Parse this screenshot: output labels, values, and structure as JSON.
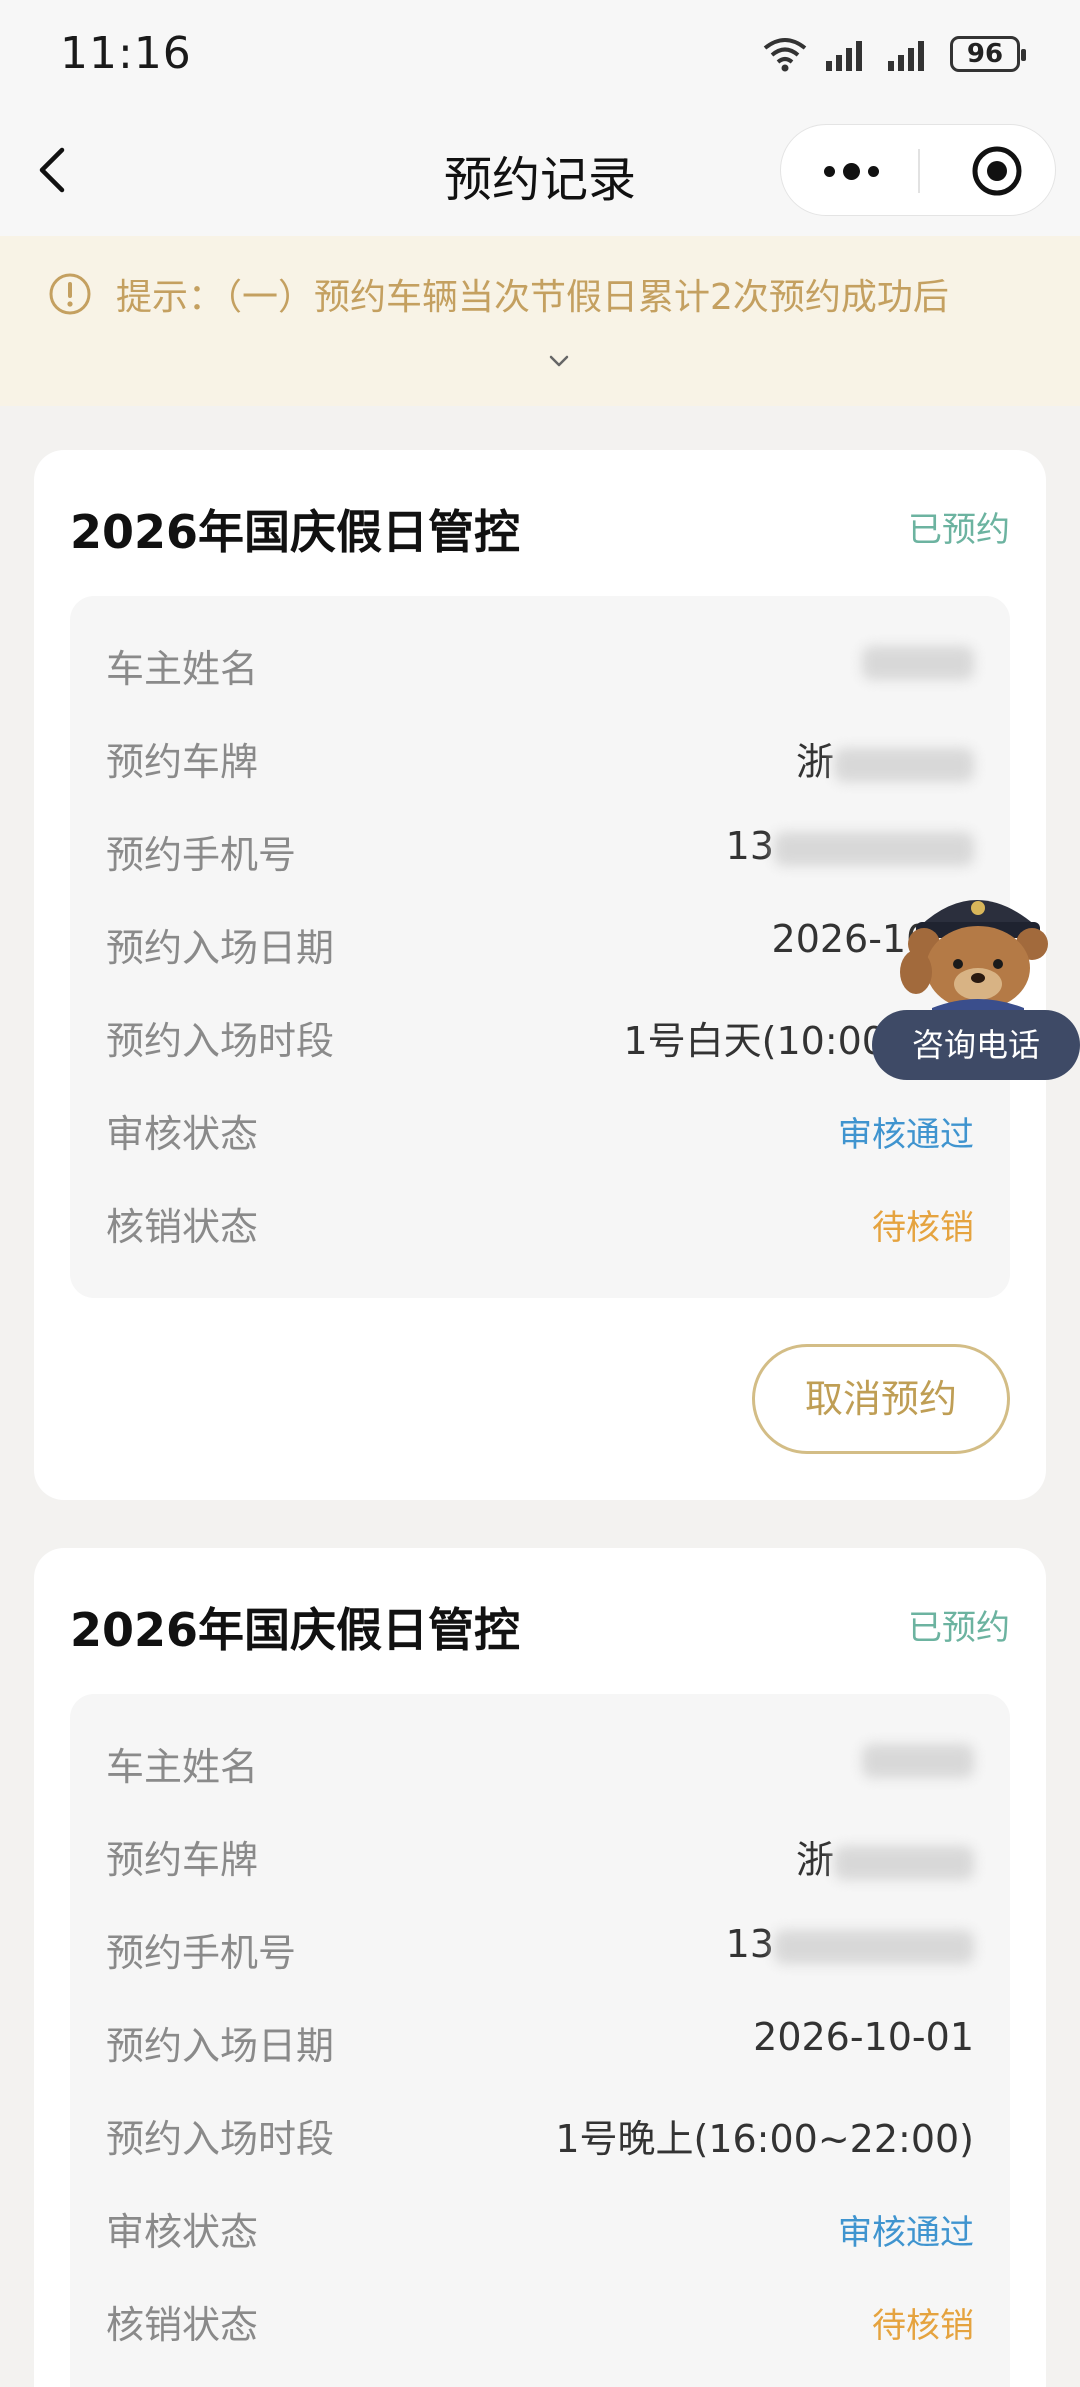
{
  "status_bar": {
    "time": "11:16",
    "battery": "96"
  },
  "nav": {
    "title": "预约记录"
  },
  "notice": {
    "text": "提示：（一）预约车辆当次节假日累计2次预约成功后"
  },
  "consult": {
    "label": "咨询电话"
  },
  "records": [
    {
      "title": "2026年国庆假日管控",
      "status": "已预约",
      "rows": [
        {
          "label": "车主姓名",
          "value": ""
        },
        {
          "label": "预约车牌",
          "value": "浙"
        },
        {
          "label": "预约手机号",
          "value": "13"
        },
        {
          "label": "预约入场日期",
          "value": "2026-10-"
        },
        {
          "label": "预约入场时段",
          "value": "1号白天(10:00~1"
        },
        {
          "label": "审核状态",
          "value": "审核通过"
        },
        {
          "label": "核销状态",
          "value": "待核销"
        }
      ],
      "cancel_label": "取消预约"
    },
    {
      "title": "2026年国庆假日管控",
      "status": "已预约",
      "rows": [
        {
          "label": "车主姓名",
          "value": ""
        },
        {
          "label": "预约车牌",
          "value": "浙"
        },
        {
          "label": "预约手机号",
          "value": "13"
        },
        {
          "label": "预约入场日期",
          "value": "2026-10-01"
        },
        {
          "label": "预约入场时段",
          "value": "1号晚上(16:00~22:00)"
        },
        {
          "label": "审核状态",
          "value": "审核通过"
        },
        {
          "label": "核销状态",
          "value": "待核销"
        }
      ]
    }
  ],
  "colors": {
    "accent_gold": "#bf9e55",
    "reserved_green": "#6cb3a0",
    "approved_blue": "#3f94cf",
    "pending_orange": "#e5a33f"
  }
}
